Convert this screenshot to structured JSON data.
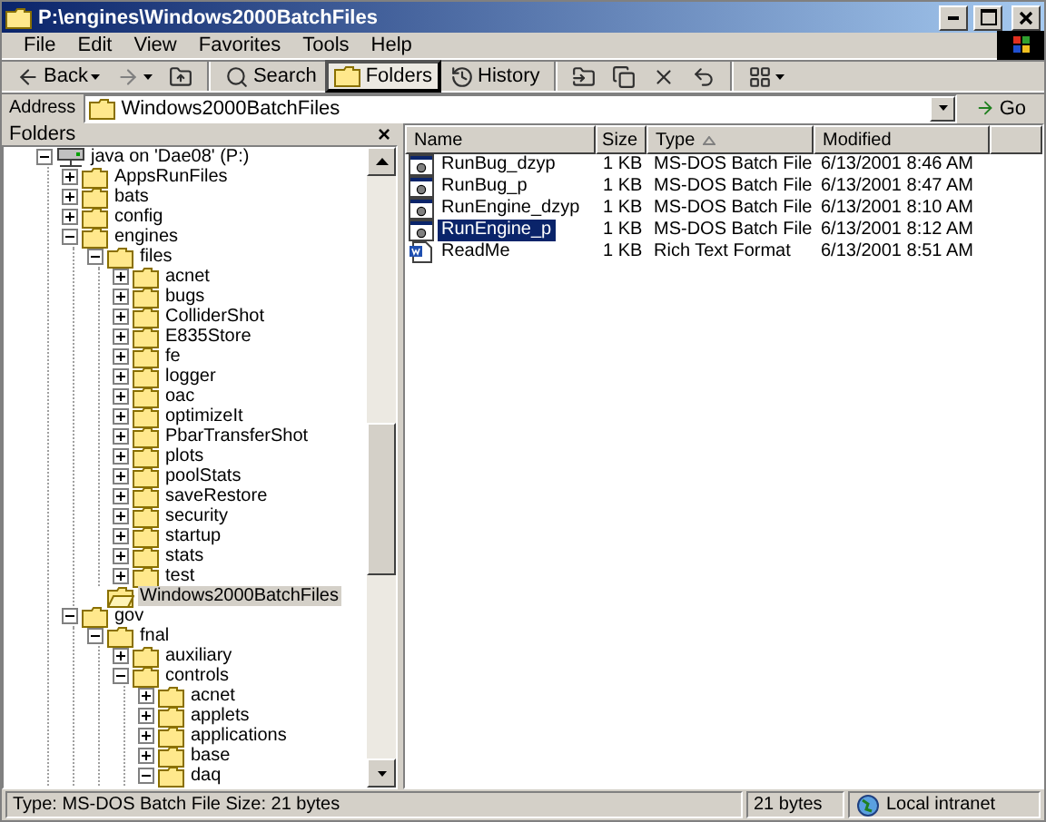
{
  "window": {
    "title": "P:\\engines\\Windows2000BatchFiles"
  },
  "menu": [
    "File",
    "Edit",
    "View",
    "Favorites",
    "Tools",
    "Help"
  ],
  "toolbar": [
    {
      "kind": "back",
      "label": "Back",
      "selected": false,
      "disabled": false
    },
    {
      "kind": "forward",
      "selected": false,
      "disabled": true
    },
    {
      "kind": "up",
      "selected": false,
      "disabled": false
    },
    {
      "kind": "search",
      "label": "Search",
      "selected": false,
      "disabled": false
    },
    {
      "kind": "folders",
      "label": "Folders",
      "selected": true,
      "disabled": false
    },
    {
      "kind": "history",
      "label": "History",
      "selected": false,
      "disabled": false
    },
    {
      "kind": "move",
      "selected": false,
      "disabled": false
    },
    {
      "kind": "copy",
      "selected": false,
      "disabled": false
    },
    {
      "kind": "delete",
      "selected": false,
      "disabled": false
    },
    {
      "kind": "undo",
      "selected": false,
      "disabled": false
    },
    {
      "kind": "views",
      "selected": false,
      "disabled": false
    }
  ],
  "address": {
    "label": "Address",
    "value": "Windows2000BatchFiles",
    "go": "Go"
  },
  "folders_pane": {
    "title": "Folders",
    "close": "×"
  },
  "tree": {
    "items": [
      {
        "kind": "drive",
        "label": "java on 'Dae08' (P:)",
        "has_subfolders": true,
        "expanded": true,
        "selected": false,
        "children": [
          {
            "kind": "folder",
            "label": "AppsRunFiles",
            "has_subfolders": true,
            "expanded": false,
            "selected": false
          },
          {
            "kind": "folder",
            "label": "bats",
            "has_subfolders": true,
            "expanded": false,
            "selected": false
          },
          {
            "kind": "folder",
            "label": "config",
            "has_subfolders": true,
            "expanded": false,
            "selected": false
          },
          {
            "kind": "folder",
            "label": "engines",
            "has_subfolders": true,
            "expanded": true,
            "selected": false,
            "children": [
              {
                "kind": "folder",
                "label": "files",
                "has_subfolders": true,
                "expanded": true,
                "selected": false,
                "children": [
                  {
                    "kind": "folder",
                    "label": "acnet",
                    "has_subfolders": true,
                    "expanded": false,
                    "selected": false
                  },
                  {
                    "kind": "folder",
                    "label": "bugs",
                    "has_subfolders": true,
                    "expanded": false,
                    "selected": false
                  },
                  {
                    "kind": "folder",
                    "label": "ColliderShot",
                    "has_subfolders": true,
                    "expanded": false,
                    "selected": false
                  },
                  {
                    "kind": "folder",
                    "label": "E835Store",
                    "has_subfolders": true,
                    "expanded": false,
                    "selected": false
                  },
                  {
                    "kind": "folder",
                    "label": "fe",
                    "has_subfolders": true,
                    "expanded": false,
                    "selected": false
                  },
                  {
                    "kind": "folder",
                    "label": "logger",
                    "has_subfolders": true,
                    "expanded": false,
                    "selected": false
                  },
                  {
                    "kind": "folder",
                    "label": "oac",
                    "has_subfolders": true,
                    "expanded": false,
                    "selected": false
                  },
                  {
                    "kind": "folder",
                    "label": "optimizeIt",
                    "has_subfolders": true,
                    "expanded": false,
                    "selected": false
                  },
                  {
                    "kind": "folder",
                    "label": "PbarTransferShot",
                    "has_subfolders": true,
                    "expanded": false,
                    "selected": false
                  },
                  {
                    "kind": "folder",
                    "label": "plots",
                    "has_subfolders": true,
                    "expanded": false,
                    "selected": false
                  },
                  {
                    "kind": "folder",
                    "label": "poolStats",
                    "has_subfolders": true,
                    "expanded": false,
                    "selected": false
                  },
                  {
                    "kind": "folder",
                    "label": "saveRestore",
                    "has_subfolders": true,
                    "expanded": false,
                    "selected": false
                  },
                  {
                    "kind": "folder",
                    "label": "security",
                    "has_subfolders": true,
                    "expanded": false,
                    "selected": false
                  },
                  {
                    "kind": "folder",
                    "label": "startup",
                    "has_subfolders": true,
                    "expanded": false,
                    "selected": false
                  },
                  {
                    "kind": "folder",
                    "label": "stats",
                    "has_subfolders": true,
                    "expanded": false,
                    "selected": false
                  },
                  {
                    "kind": "folder",
                    "label": "test",
                    "has_subfolders": true,
                    "expanded": false,
                    "selected": false
                  }
                ]
              },
              {
                "kind": "folder",
                "label": "Windows2000BatchFiles",
                "has_subfolders": false,
                "expanded": false,
                "selected": true
              }
            ]
          },
          {
            "kind": "folder",
            "label": "gov",
            "has_subfolders": true,
            "expanded": true,
            "selected": false,
            "children": [
              {
                "kind": "folder",
                "label": "fnal",
                "has_subfolders": true,
                "expanded": true,
                "selected": false,
                "children": [
                  {
                    "kind": "folder",
                    "label": "auxiliary",
                    "has_subfolders": true,
                    "expanded": false,
                    "selected": false
                  },
                  {
                    "kind": "folder",
                    "label": "controls",
                    "has_subfolders": true,
                    "expanded": true,
                    "selected": false,
                    "children": [
                      {
                        "kind": "folder",
                        "label": "acnet",
                        "has_subfolders": true,
                        "expanded": false,
                        "selected": false
                      },
                      {
                        "kind": "folder",
                        "label": "applets",
                        "has_subfolders": true,
                        "expanded": false,
                        "selected": false
                      },
                      {
                        "kind": "folder",
                        "label": "applications",
                        "has_subfolders": true,
                        "expanded": false,
                        "selected": false
                      },
                      {
                        "kind": "folder",
                        "label": "base",
                        "has_subfolders": true,
                        "expanded": false,
                        "selected": false
                      },
                      {
                        "kind": "folder",
                        "label": "daq",
                        "has_subfolders": true,
                        "expanded": true,
                        "selected": false
                      }
                    ]
                  }
                ]
              }
            ]
          }
        ]
      }
    ]
  },
  "list": {
    "columns": [
      {
        "label": "Name",
        "sorted": false
      },
      {
        "label": "Size",
        "sorted": false
      },
      {
        "label": "Type",
        "sorted": true
      },
      {
        "label": "Modified",
        "sorted": false
      }
    ],
    "rows": [
      {
        "kind": "batch",
        "name": "RunBug_dzyp",
        "size": "1 KB",
        "type": "MS-DOS Batch File",
        "modified": "6/13/2001 8:46 AM",
        "selected": false
      },
      {
        "kind": "batch",
        "name": "RunBug_p",
        "size": "1 KB",
        "type": "MS-DOS Batch File",
        "modified": "6/13/2001 8:47 AM",
        "selected": false
      },
      {
        "kind": "batch",
        "name": "RunEngine_dzyp",
        "size": "1 KB",
        "type": "MS-DOS Batch File",
        "modified": "6/13/2001 8:10 AM",
        "selected": false
      },
      {
        "kind": "batch",
        "name": "RunEngine_p",
        "size": "1 KB",
        "type": "MS-DOS Batch File",
        "modified": "6/13/2001 8:12 AM",
        "selected": true
      },
      {
        "kind": "rtf",
        "name": "ReadMe",
        "size": "1 KB",
        "type": "Rich Text Format",
        "modified": "6/13/2001 8:51 AM",
        "selected": false
      }
    ]
  },
  "status_bar": {
    "text": "Type: MS-DOS Batch File Size: 21 bytes",
    "size": "21 bytes",
    "zone": "Local intranet"
  }
}
